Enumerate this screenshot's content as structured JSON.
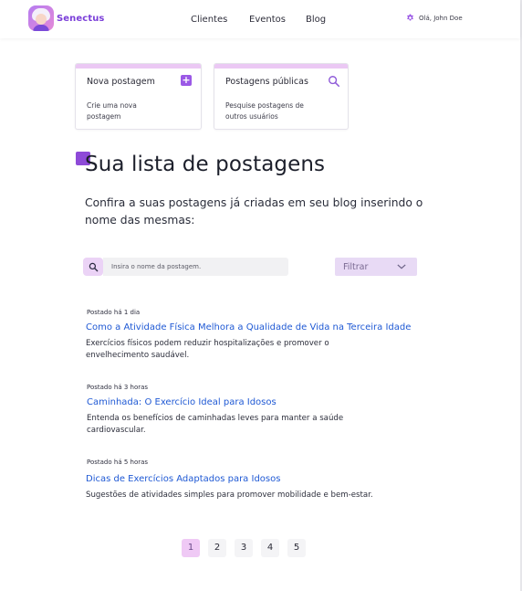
{
  "brand": {
    "name": "Senectus",
    "logo_icon": "grandmother-avatar-icon"
  },
  "nav": {
    "items": [
      "Clientes",
      "Eventos",
      "Blog"
    ]
  },
  "user": {
    "greeting": "Olá, John Doe",
    "icon": "gear-icon"
  },
  "cards": [
    {
      "title": "Nova postagem",
      "description": "Crie uma nova postagem",
      "icon": "plus-square-icon"
    },
    {
      "title": "Postagens públicas",
      "description": "Pesquise  postagens de outros usuários",
      "icon": "search-icon"
    }
  ],
  "main": {
    "heading": "Sua lista de postagens",
    "intro": "Confira a suas postagens já criadas em seu blog inserindo o nome das mesmas:"
  },
  "search": {
    "placeholder": "Insira o nome da postagem.",
    "value": ""
  },
  "filter": {
    "label": "Filtrar"
  },
  "posts": [
    {
      "time": "Postado há 1 dia",
      "title": "Como a Atividade Física Melhora a Qualidade de Vida na Terceira Idade",
      "excerpt": "Exercícios físicos podem reduzir hospitalizações e promover o envelhecimento saudável."
    },
    {
      "time": "Postado há 3 horas",
      "title": "Caminhada: O Exercício Ideal para Idosos",
      "excerpt": "Entenda os benefícios de caminhadas leves para manter a saúde cardiovascular."
    },
    {
      "time": "Postado há 5 horas",
      "title": "Dicas de Exercícios Adaptados para Idosos",
      "excerpt": "Sugestões de atividades simples para promover mobilidade e bem-estar."
    }
  ],
  "pagination": {
    "pages": [
      "1",
      "2",
      "3",
      "4",
      "5"
    ],
    "current": "1"
  },
  "colors": {
    "accent": "#8e4ad8",
    "card_bar": "#ebc8f4",
    "link": "#1f59d4",
    "filter_bg": "#e8daf5"
  }
}
